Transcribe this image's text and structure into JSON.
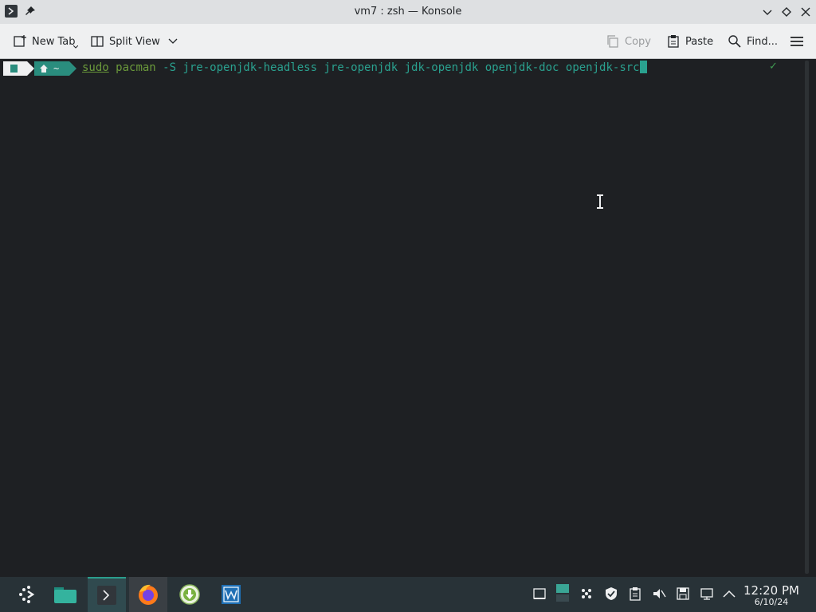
{
  "window": {
    "title": "vm7 : zsh — Konsole"
  },
  "toolbar": {
    "new_tab": "New Tab",
    "split_view": "Split View",
    "copy": "Copy",
    "paste": "Paste",
    "find": "Find..."
  },
  "terminal": {
    "prompt_dir": "~",
    "cmd_sudo": "sudo",
    "cmd_pacman": "pacman",
    "cmd_args": " -S jre-openjdk-headless jre-openjdk jdk-openjdk openjdk-doc openjdk-src",
    "status_mark": "✓"
  },
  "taskbar": {
    "apps": [
      "app-launcher-icon",
      "file-manager-icon",
      "konsole-icon",
      "firefox-icon",
      "download-icon",
      "virt-manager-icon"
    ],
    "tray": [
      "window-icon",
      "workspace-icon",
      "network-icon",
      "shield-icon",
      "clipboard-icon",
      "volume-muted-icon",
      "save-icon",
      "display-icon",
      "chevron-up-icon"
    ],
    "time": "12:20 PM",
    "date": "6/10/24"
  },
  "colors": {
    "accent": "#2a9d8c",
    "terminal_bg": "#1e2023",
    "command_green": "#6b9a3b"
  }
}
